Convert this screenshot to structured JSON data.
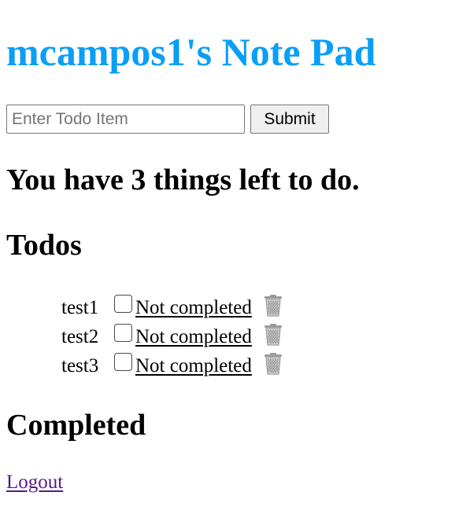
{
  "app": {
    "title": "mcampos1's Note Pad",
    "accent_color": "#0a9ff5"
  },
  "form": {
    "input_placeholder": "Enter Todo Item",
    "input_value": "",
    "submit_label": "Submit"
  },
  "summary": {
    "remaining_text": "You have 3 things left to do."
  },
  "todos": {
    "heading": "Todos",
    "items": [
      {
        "text": "test1",
        "checked": false,
        "status_label": "Not completed",
        "delete_icon": "trash-icon"
      },
      {
        "text": "test2",
        "checked": false,
        "status_label": "Not completed",
        "delete_icon": "trash-icon"
      },
      {
        "text": "test3",
        "checked": false,
        "status_label": "Not completed",
        "delete_icon": "trash-icon"
      }
    ]
  },
  "completed": {
    "heading": "Completed",
    "items": []
  },
  "footer": {
    "logout_label": "Logout",
    "link_visited_color": "#551a8b"
  }
}
